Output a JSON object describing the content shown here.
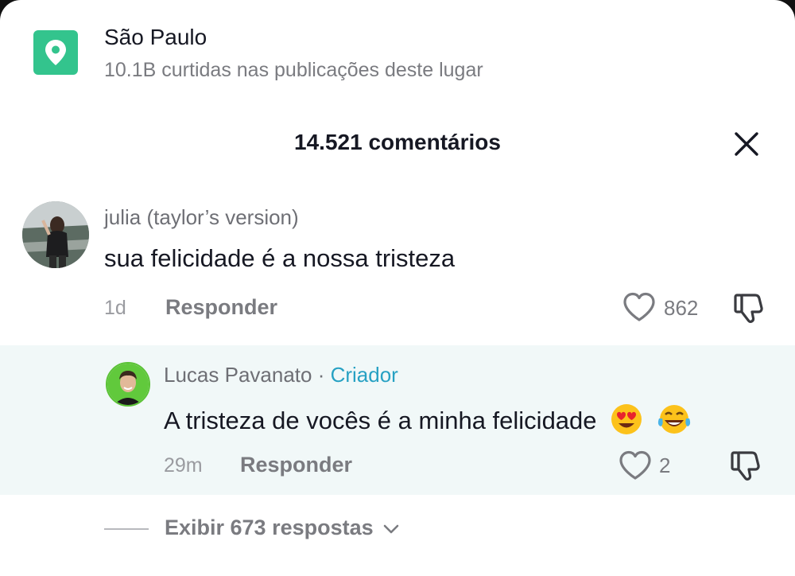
{
  "location": {
    "name": "São Paulo",
    "subtitle": "10.1B curtidas nas publicações deste lugar",
    "icon": "location-pin-icon",
    "icon_bg": "#33c48d"
  },
  "header": {
    "title": "14.521 comentários",
    "close_icon": "close-icon"
  },
  "comments": [
    {
      "username": "julia (taylor’s version)",
      "text": "sua felicidade é a nossa tristeza",
      "time": "1d",
      "reply_label": "Responder",
      "likes": "862"
    }
  ],
  "reply": {
    "username": "Lucas Pavanato",
    "separator": " · ",
    "tag": "Criador",
    "text": "A tristeza de vocês é a minha felicidade",
    "emojis": [
      "heart-eyes-emoji",
      "tears-of-joy-emoji"
    ],
    "time": "29m",
    "reply_label": "Responder",
    "likes": "2"
  },
  "view_replies": {
    "label": "Exibir 673 respostas"
  },
  "colors": {
    "accent_creator": "#27a1c3",
    "reply_background": "#f1f8f8",
    "muted_text": "#7a7b80"
  }
}
